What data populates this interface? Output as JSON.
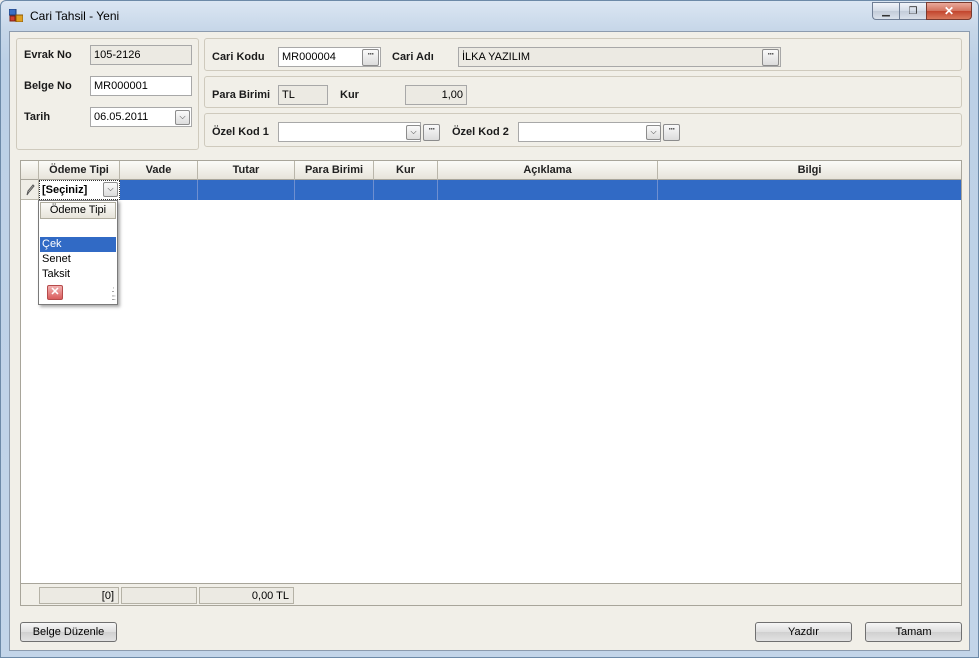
{
  "window": {
    "title": "Cari Tahsil - Yeni"
  },
  "document": {
    "evrak_no_label": "Evrak No",
    "evrak_no": "105-2126",
    "belge_no_label": "Belge No",
    "belge_no": "MR000001",
    "tarih_label": "Tarih",
    "tarih": "06.05.2011"
  },
  "cari": {
    "kodu_label": "Cari Kodu",
    "kodu": "MR000004",
    "adi_label": "Cari Adı",
    "adi": "İLKA YAZILIM"
  },
  "currency": {
    "para_birimi_label": "Para Birimi",
    "para_birimi": "TL",
    "kur_label": "Kur",
    "kur": "1,00"
  },
  "codes": {
    "ozel_kod_1_label": "Özel Kod 1",
    "ozel_kod_1": "",
    "ozel_kod_2_label": "Özel Kod 2",
    "ozel_kod_2": ""
  },
  "grid": {
    "columns": [
      "Ödeme Tipi",
      "Vade",
      "Tutar",
      "Para Birimi",
      "Kur",
      "Açıklama",
      "Bilgi"
    ],
    "edit_value": "[Seçiniz]",
    "footer": {
      "count": "[0]",
      "empty": "",
      "total": "0,00 TL"
    }
  },
  "popup": {
    "header": "Ödeme Tipi",
    "options": [
      "",
      "Çek",
      "Senet",
      "Taksit"
    ],
    "selected": "Çek"
  },
  "buttons": {
    "belge_duzenle": "Belge Düzenle",
    "yazdir": "Yazdır",
    "tamam": "Tamam"
  },
  "colors": {
    "selection": "#316ac5",
    "panel_bg": "#f1efe8",
    "close_button": "#c2452d"
  }
}
